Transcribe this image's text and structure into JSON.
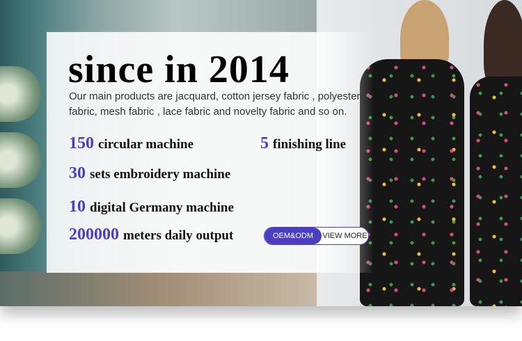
{
  "title": "since in 2014",
  "description": "Our main products are jacquard, cotton jersey fabric , polyester fabric, mesh fabric , lace fabric and novelty fabric and so on.",
  "stats": [
    {
      "num": "150",
      "label": "circular machine"
    },
    {
      "num": "5",
      "label": "finishing line"
    },
    {
      "num": "30",
      "label": "sets embroidery machine"
    },
    {
      "num": "10",
      "label": "digital Germany machine"
    },
    {
      "num": "200000",
      "label": "meters daily output"
    }
  ],
  "cta": {
    "primary": "OEM&ODM",
    "secondary": "VIEW MORE"
  },
  "colors": {
    "accent": "#4b3fc0"
  }
}
